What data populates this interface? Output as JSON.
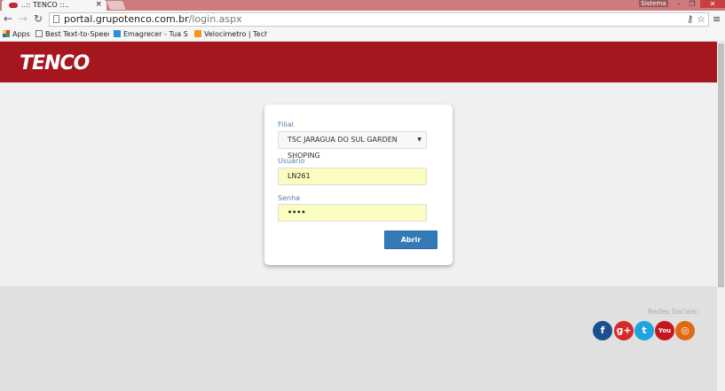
{
  "browser": {
    "tab_title": "..:: TENCO ::..",
    "tab_close": "×",
    "sistema": "Sistema",
    "url_host": "portal.grupotenco.com.br",
    "url_path": "/login.aspx",
    "bookmarks": [
      {
        "label": "Apps"
      },
      {
        "label": "Best Text-to-Speech D"
      },
      {
        "label": "Emagrecer - Tua Saúd"
      },
      {
        "label": "Velocimetro | TechTud"
      }
    ]
  },
  "header": {
    "logo": "TENCO"
  },
  "login": {
    "filial_label": "Filial",
    "filial_value": "TSC JARAGUA DO SUL GARDEN SHOPING",
    "usuario_label": "Usuário",
    "usuario_value": "LN261",
    "senha_label": "Senha",
    "senha_value": "••••",
    "submit": "Abrir"
  },
  "footer": {
    "redes_label": "Redes Sociais:",
    "social": [
      {
        "name": "facebook",
        "glyph": "f",
        "color": "#1a4e8c"
      },
      {
        "name": "google-plus",
        "glyph": "g+",
        "color": "#d7282a"
      },
      {
        "name": "twitter",
        "glyph": "t",
        "color": "#1fa3dc"
      },
      {
        "name": "youtube",
        "glyph": "You",
        "color": "#c4161c"
      },
      {
        "name": "instagram",
        "glyph": "◎",
        "color": "#e06a12"
      }
    ]
  }
}
